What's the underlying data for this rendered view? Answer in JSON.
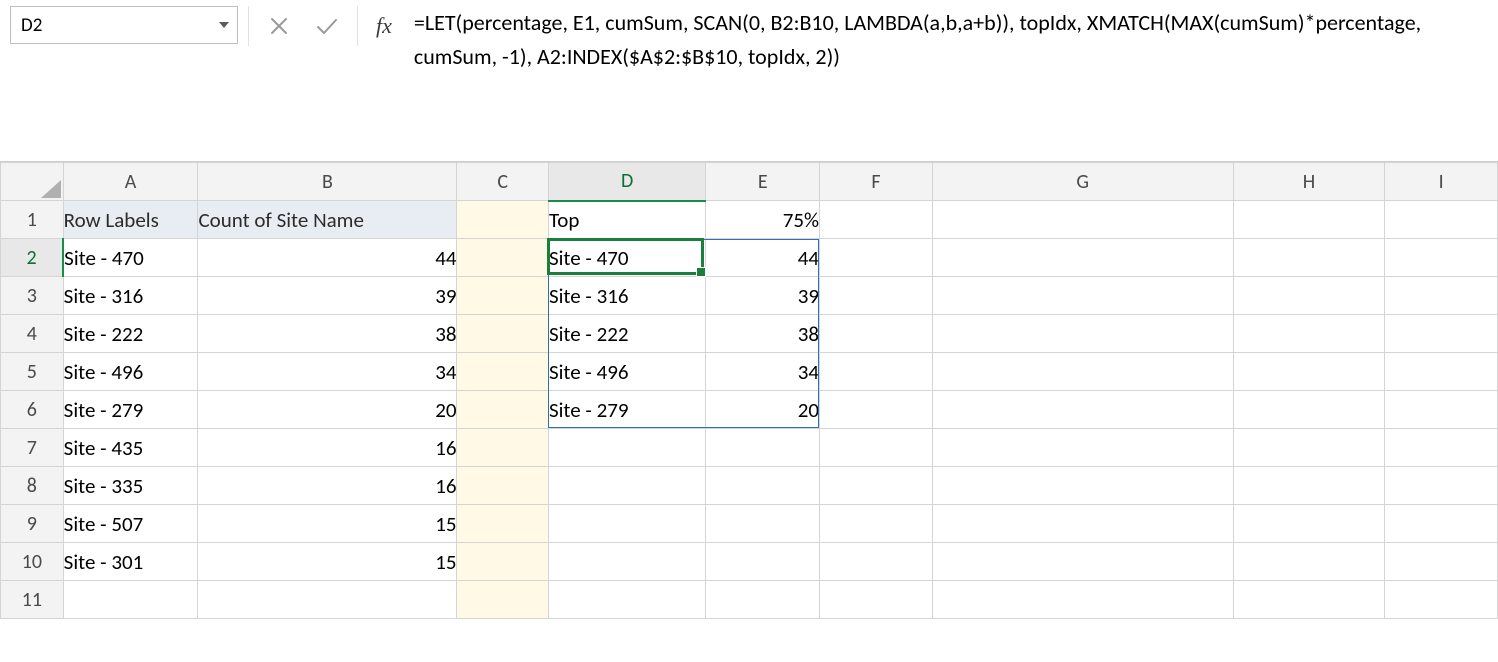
{
  "formula_bar": {
    "name_box": "D2",
    "formula": "=LET(percentage, E1, cumSum, SCAN(0, B2:B10, LAMBDA(a,b,a+b)), topIdx, XMATCH(MAX(cumSum)*percentage, cumSum, -1), A2:INDEX($A$2:$B$10, topIdx, 2))",
    "fx_label": "fx"
  },
  "columns": [
    "A",
    "B",
    "C",
    "D",
    "E",
    "F",
    "G",
    "H",
    "I"
  ],
  "rows": [
    1,
    2,
    3,
    4,
    5,
    6,
    7,
    8,
    9,
    10,
    11
  ],
  "active_cell": "D2",
  "active_row": 2,
  "active_col": "D",
  "spill": {
    "from": "D2",
    "to": "E6"
  },
  "cells": {
    "A1": "Row Labels",
    "B1": "Count of Site Name",
    "D1": "Top",
    "E1": "75%",
    "A2": "Site - 470",
    "B2": "44",
    "D2": "Site - 470",
    "E2": "44",
    "A3": "Site - 316",
    "B3": "39",
    "D3": "Site - 316",
    "E3": "39",
    "A4": "Site - 222",
    "B4": "38",
    "D4": "Site - 222",
    "E4": "38",
    "A5": "Site - 496",
    "B5": "34",
    "D5": "Site - 496",
    "E5": "34",
    "A6": "Site - 279",
    "B6": "20",
    "D6": "Site - 279",
    "E6": "20",
    "A7": "Site - 435",
    "B7": "16",
    "A8": "Site - 335",
    "B8": "16",
    "A9": "Site - 507",
    "B9": "15",
    "A10": "Site - 301",
    "B10": "15"
  }
}
